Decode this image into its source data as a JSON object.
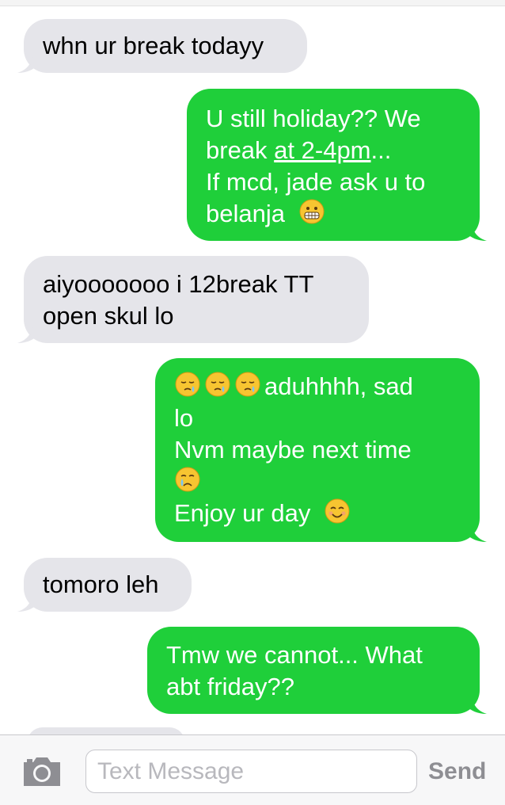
{
  "messages": [
    {
      "side": "in",
      "lines": [
        "whn ur break todayy"
      ]
    },
    {
      "side": "out",
      "line1": "U still holiday?? We",
      "line2_pre": "break ",
      "line2_link": "at 2-4pm",
      "line2_post": "...",
      "line3": "If mcd, jade ask u to",
      "line4": "belanja",
      "emoji": "grimacing-face"
    },
    {
      "side": "in",
      "line1": "aiyooooooo i 12break TT",
      "line2": "open skul lo"
    },
    {
      "side": "out",
      "line1": "aduhhhh, sad",
      "line2": "lo",
      "line3": "Nvm maybe next time",
      "line5": "Enjoy ur day",
      "emojis": [
        "sleepy-face",
        "sleepy-face",
        "sleepy-face",
        "crying-face",
        "smiling-face"
      ]
    },
    {
      "side": "in",
      "line1": "tomoro leh"
    },
    {
      "side": "out",
      "line1": "Tmw we cannot... What",
      "line2": "abt friday??"
    }
  ],
  "composer": {
    "placeholder": "Text Message",
    "send_label": "Send",
    "camera_icon": "camera-icon"
  },
  "colors": {
    "incoming": "#e5e5ea",
    "outgoing": "#1fcf3a"
  }
}
